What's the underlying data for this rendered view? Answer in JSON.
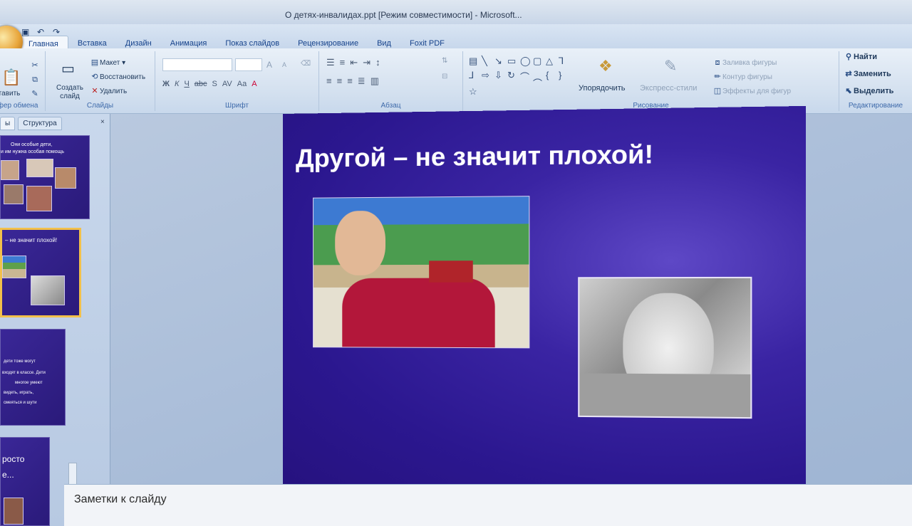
{
  "window": {
    "title": "О детях-инвалидах.ppt [Режим совместимости] - Microsoft..."
  },
  "quick_access": {
    "icons": [
      "save-icon",
      "undo-icon",
      "redo-icon"
    ]
  },
  "tabs": [
    {
      "label": "Главная",
      "active": true
    },
    {
      "label": "Вставка"
    },
    {
      "label": "Дизайн"
    },
    {
      "label": "Анимация"
    },
    {
      "label": "Показ слайдов"
    },
    {
      "label": "Рецензирование"
    },
    {
      "label": "Вид"
    },
    {
      "label": "Foxit PDF"
    }
  ],
  "ribbon": {
    "clipboard": {
      "paste": "Вставить",
      "label": "Буфер обмена"
    },
    "slides": {
      "new_slide": "Создать слайд",
      "layout": "Макет",
      "reset": "Восстановить",
      "delete": "Удалить",
      "label": "Слайды"
    },
    "font": {
      "label": "Шрифт",
      "bold": "Ж",
      "italic": "К",
      "underline": "Ч",
      "strike": "abc",
      "spacing": "AV",
      "case": "Aa",
      "grow": "A",
      "shrink": "A"
    },
    "paragraph": {
      "label": "Абзац"
    },
    "drawing": {
      "arrange": "Упорядочить",
      "quick_styles": "Экспресс-стили",
      "fill": "Заливка фигуры",
      "outline": "Контур фигуры",
      "effects": "Эффекты для фигур",
      "label": "Рисование"
    },
    "editing": {
      "find": "Найти",
      "replace": "Заменить",
      "select": "Выделить",
      "label": "Редактирование"
    }
  },
  "panel": {
    "tabs": [
      {
        "label": "ы",
        "active": true
      },
      {
        "label": "Структура"
      }
    ],
    "close": "×",
    "thumbnails": [
      {
        "lines": [
          "Они особые дети,",
          "и им нужна особая помощь"
        ]
      },
      {
        "lines": [
          "– не значит плохой!"
        ],
        "selected": true
      },
      {
        "lines": [
          "дети тоже могут",
          "входят в классе. Дети",
          "многое умеют",
          "видеть, играть,",
          "смеяться и шути"
        ]
      },
      {
        "lines": [
          "росто",
          "е..."
        ]
      }
    ]
  },
  "slide": {
    "title": "Другой – не значит плохой!"
  },
  "notes": {
    "placeholder": "Заметки к слайду"
  }
}
